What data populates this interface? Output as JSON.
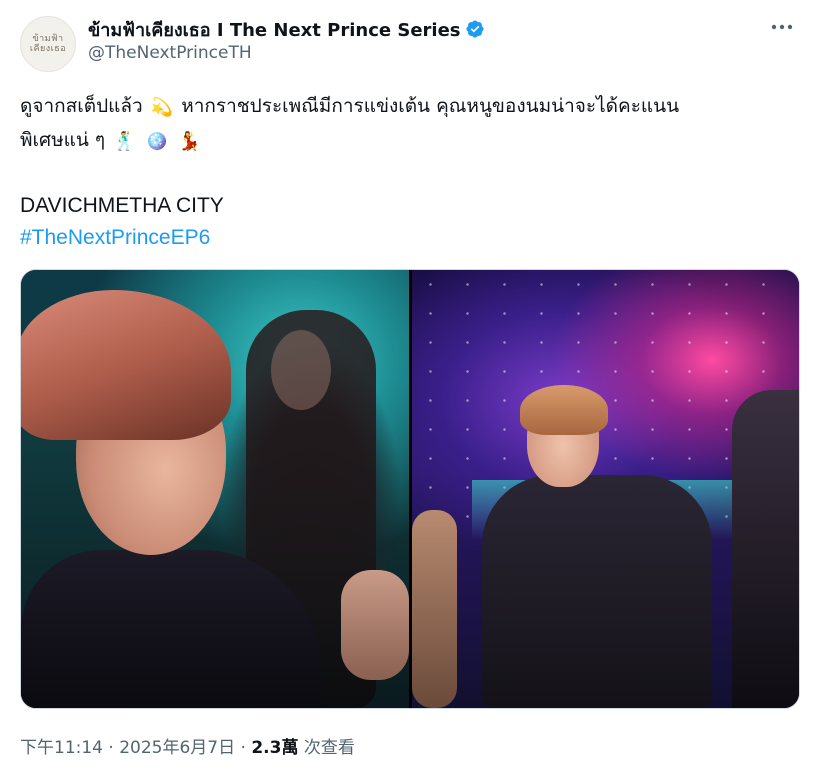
{
  "account": {
    "display_name": "ข้ามฟ้าเคียงเธอ I The Next Prince Series",
    "handle": "@TheNextPrinceTH",
    "avatar_text": "ข้ามฟ้า เคียงเธอ",
    "verified_icon": "verified-badge-icon",
    "verified_color": "#1d9bf0"
  },
  "more_icon": "more-horizontal-icon",
  "tweet": {
    "line1_a": "ดูจากสเต็ปแล้ว",
    "emoji_1": "💫",
    "line1_b": "หากราชประเพณีมีการแข่งเต้น คุณหนูของนมน่าจะได้คะแนน",
    "line2_a": "พิเศษแน่ ๆ",
    "emoji_2": "🕺",
    "emoji_3": "🪩",
    "emoji_4": "💃",
    "city": "DAVICHMETHA CITY",
    "hashtag": "#TheNextPrinceEP6"
  },
  "footer": {
    "time": "下午11:14",
    "sep1": "·",
    "date": "2025年6月7日",
    "sep2": "·",
    "views_count": "2.3萬",
    "views_label": "次查看"
  },
  "colors": {
    "link": "#1d9bf0",
    "secondary_text": "#536471",
    "border": "#cfd9de"
  }
}
